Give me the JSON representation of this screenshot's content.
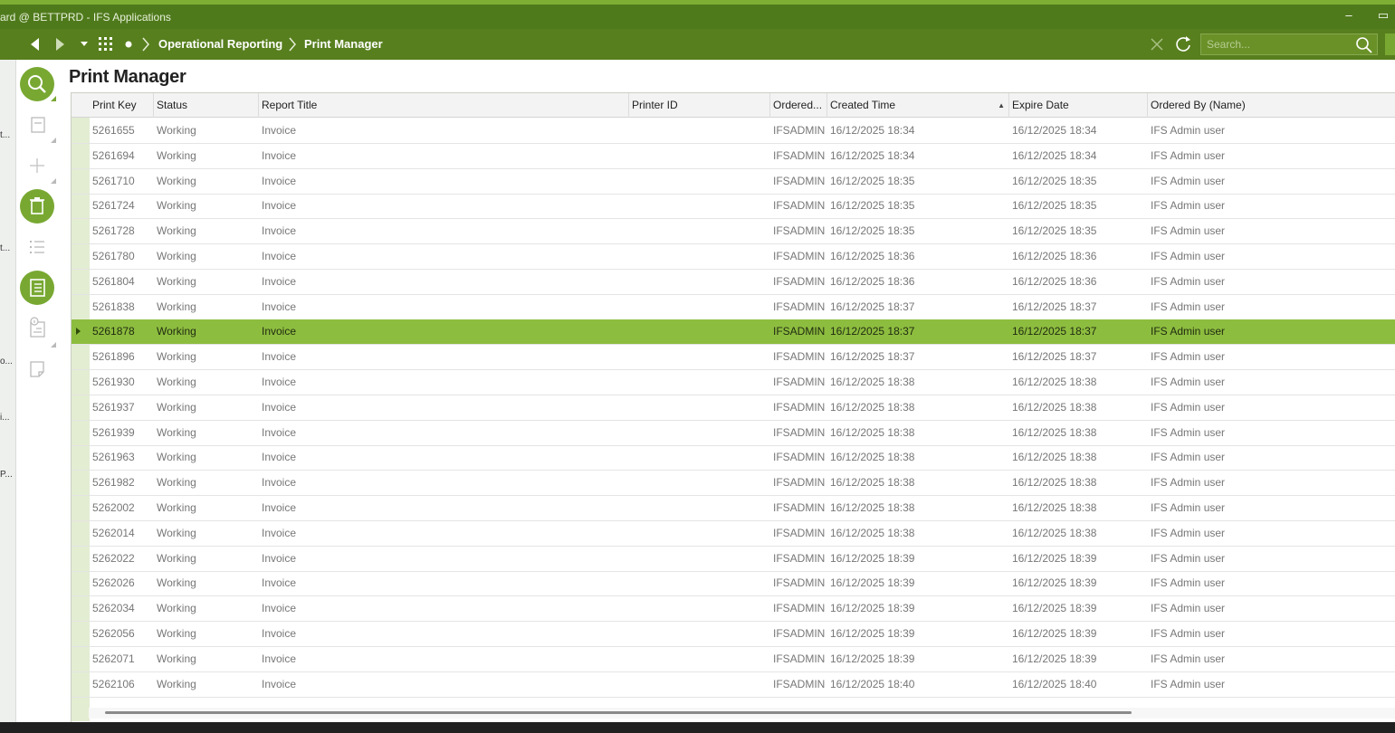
{
  "window": {
    "title": "ard @ BETTPRD - IFS Applications",
    "minimize_label": "–",
    "maximize_label": "▭"
  },
  "nav": {
    "breadcrumb": [
      "Operational Reporting",
      "Print Manager"
    ],
    "search_placeholder": "Search..."
  },
  "left_strip": [
    "t...",
    "t...",
    "o...",
    "i...",
    "P..."
  ],
  "page": {
    "title": "Print Manager"
  },
  "table": {
    "columns": [
      "Print Key",
      "Status",
      "Report Title",
      "Printer ID",
      "Ordered...",
      "Created Time",
      "Expire Date",
      "Ordered By (Name)"
    ],
    "sorted_column": "Created Time",
    "sort_direction": "ascending",
    "selected_row_index": 8,
    "rows": [
      [
        "5261655",
        "Working",
        "Invoice",
        "",
        "IFSADMIN",
        "16/12/2025 18:34",
        "16/12/2025 18:34",
        "IFS Admin user"
      ],
      [
        "5261694",
        "Working",
        "Invoice",
        "",
        "IFSADMIN",
        "16/12/2025 18:34",
        "16/12/2025 18:34",
        "IFS Admin user"
      ],
      [
        "5261710",
        "Working",
        "Invoice",
        "",
        "IFSADMIN",
        "16/12/2025 18:35",
        "16/12/2025 18:35",
        "IFS Admin user"
      ],
      [
        "5261724",
        "Working",
        "Invoice",
        "",
        "IFSADMIN",
        "16/12/2025 18:35",
        "16/12/2025 18:35",
        "IFS Admin user"
      ],
      [
        "5261728",
        "Working",
        "Invoice",
        "",
        "IFSADMIN",
        "16/12/2025 18:35",
        "16/12/2025 18:35",
        "IFS Admin user"
      ],
      [
        "5261780",
        "Working",
        "Invoice",
        "",
        "IFSADMIN",
        "16/12/2025 18:36",
        "16/12/2025 18:36",
        "IFS Admin user"
      ],
      [
        "5261804",
        "Working",
        "Invoice",
        "",
        "IFSADMIN",
        "16/12/2025 18:36",
        "16/12/2025 18:36",
        "IFS Admin user"
      ],
      [
        "5261838",
        "Working",
        "Invoice",
        "",
        "IFSADMIN",
        "16/12/2025 18:37",
        "16/12/2025 18:37",
        "IFS Admin user"
      ],
      [
        "5261878",
        "Working",
        "Invoice",
        "",
        "IFSADMIN",
        "16/12/2025 18:37",
        "16/12/2025 18:37",
        "IFS Admin user"
      ],
      [
        "5261896",
        "Working",
        "Invoice",
        "",
        "IFSADMIN",
        "16/12/2025 18:37",
        "16/12/2025 18:37",
        "IFS Admin user"
      ],
      [
        "5261930",
        "Working",
        "Invoice",
        "",
        "IFSADMIN",
        "16/12/2025 18:38",
        "16/12/2025 18:38",
        "IFS Admin user"
      ],
      [
        "5261937",
        "Working",
        "Invoice",
        "",
        "IFSADMIN",
        "16/12/2025 18:38",
        "16/12/2025 18:38",
        "IFS Admin user"
      ],
      [
        "5261939",
        "Working",
        "Invoice",
        "",
        "IFSADMIN",
        "16/12/2025 18:38",
        "16/12/2025 18:38",
        "IFS Admin user"
      ],
      [
        "5261963",
        "Working",
        "Invoice",
        "",
        "IFSADMIN",
        "16/12/2025 18:38",
        "16/12/2025 18:38",
        "IFS Admin user"
      ],
      [
        "5261982",
        "Working",
        "Invoice",
        "",
        "IFSADMIN",
        "16/12/2025 18:38",
        "16/12/2025 18:38",
        "IFS Admin user"
      ],
      [
        "5262002",
        "Working",
        "Invoice",
        "",
        "IFSADMIN",
        "16/12/2025 18:38",
        "16/12/2025 18:38",
        "IFS Admin user"
      ],
      [
        "5262014",
        "Working",
        "Invoice",
        "",
        "IFSADMIN",
        "16/12/2025 18:38",
        "16/12/2025 18:38",
        "IFS Admin user"
      ],
      [
        "5262022",
        "Working",
        "Invoice",
        "",
        "IFSADMIN",
        "16/12/2025 18:39",
        "16/12/2025 18:39",
        "IFS Admin user"
      ],
      [
        "5262026",
        "Working",
        "Invoice",
        "",
        "IFSADMIN",
        "16/12/2025 18:39",
        "16/12/2025 18:39",
        "IFS Admin user"
      ],
      [
        "5262034",
        "Working",
        "Invoice",
        "",
        "IFSADMIN",
        "16/12/2025 18:39",
        "16/12/2025 18:39",
        "IFS Admin user"
      ],
      [
        "5262056",
        "Working",
        "Invoice",
        "",
        "IFSADMIN",
        "16/12/2025 18:39",
        "16/12/2025 18:39",
        "IFS Admin user"
      ],
      [
        "5262071",
        "Working",
        "Invoice",
        "",
        "IFSADMIN",
        "16/12/2025 18:39",
        "16/12/2025 18:39",
        "IFS Admin user"
      ],
      [
        "5262106",
        "Working",
        "Invoice",
        "",
        "IFSADMIN",
        "16/12/2025 18:40",
        "16/12/2025 18:40",
        "IFS Admin user"
      ]
    ]
  },
  "colors": {
    "titlebar": "#4f7a1c",
    "navbar": "#577f1e",
    "accent": "#78a832",
    "selected_row": "#8dbd3f"
  },
  "icons": {
    "toolbar": [
      "search-icon",
      "form-view-icon",
      "add-icon",
      "delete-icon",
      "list-view-icon",
      "detail-list-icon",
      "info-document-icon",
      "note-icon"
    ],
    "nav": [
      "back-arrow-icon",
      "forward-arrow-icon",
      "dropdown-caret-icon",
      "app-grid-icon",
      "dot-icon",
      "clear-icon",
      "refresh-icon",
      "search-icon"
    ]
  }
}
